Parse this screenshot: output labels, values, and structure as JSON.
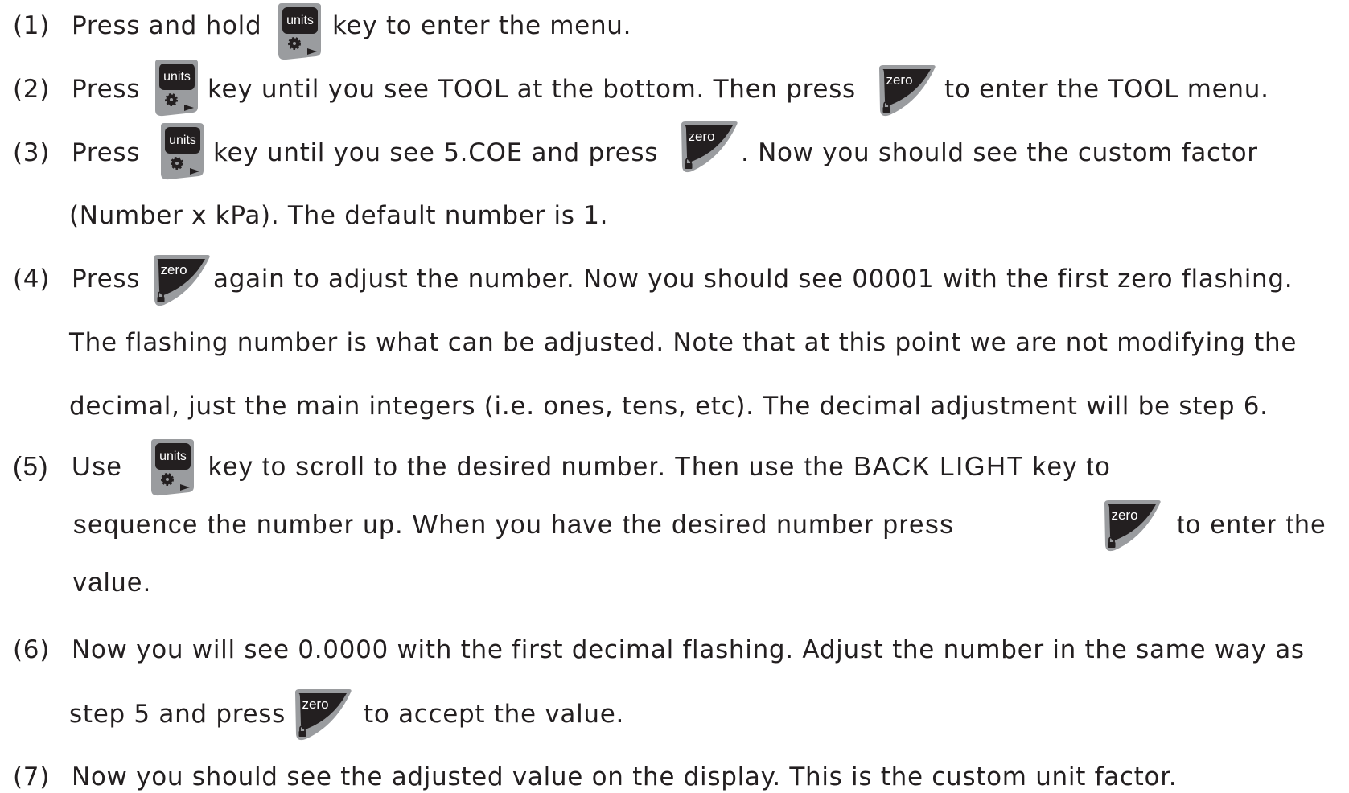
{
  "steps": [
    {
      "num": "(1)",
      "parts": [
        "Press and hold",
        "key to enter the menu."
      ]
    },
    {
      "num": "(2)",
      "parts": [
        "Press",
        "key until you see TOOL at the bottom. Then press",
        "to enter the  TOOL menu."
      ]
    },
    {
      "num": "(3)",
      "parts": [
        "Press",
        "key until you see 5.COE and press",
        ". Now you should see the custom factor",
        "(Number x kPa). The default number is 1."
      ]
    },
    {
      "num": "(4)",
      "parts": [
        "Press",
        "again to adjust the number. Now you should see 00001 with the first zero flashing.",
        "The flashing number is what can be adjusted. Note that at this point we are not modifying the",
        "decimal, just the main integers (i.e. ones, tens, etc). The decimal adjustment will be step 6."
      ]
    },
    {
      "num": "(5)",
      "parts": [
        "Use",
        "key to scroll to the desired number. Then use the BACK LIGHT key to",
        "sequence the number up. When you have the desired number press",
        "to enter the",
        "value."
      ]
    },
    {
      "num": "(6)",
      "parts": [
        "Now you will see 0.0000 with the first decimal flashing. Adjust the number in the same way as",
        "step 5 and press",
        "to accept the value."
      ]
    },
    {
      "num": "(7)",
      "parts": [
        "Now you should see the adjusted value on the display. This is the custom unit factor."
      ]
    }
  ],
  "keys": {
    "units_label": "units",
    "zero_label": "zero",
    "units_icon": "gear-icon",
    "units_arrow_icon": "play-arrow-icon",
    "zero_icon": "lock-icon"
  },
  "colors": {
    "text": "#231f20",
    "key_face": "#231f20",
    "key_body": "#9a9c9f"
  }
}
